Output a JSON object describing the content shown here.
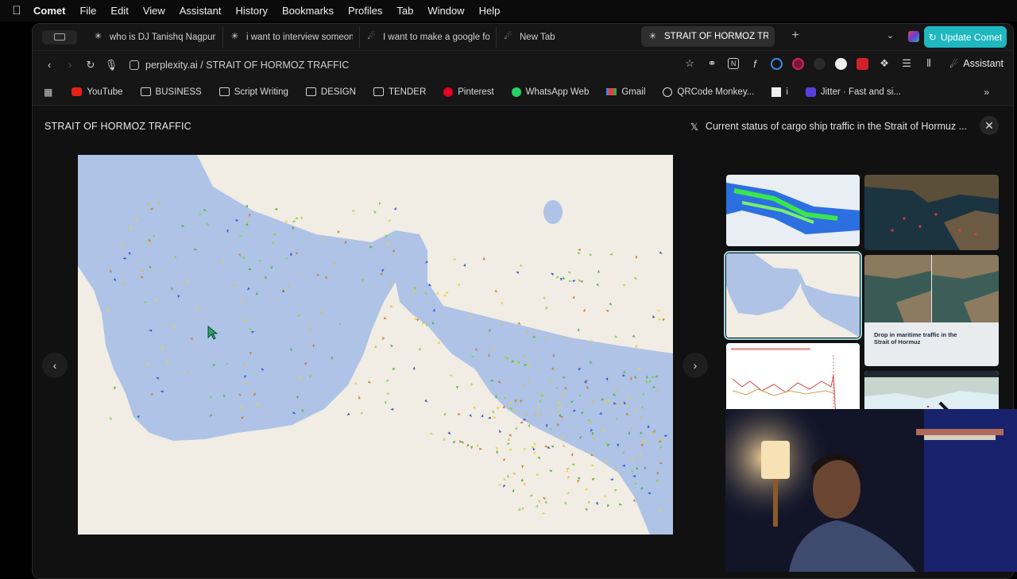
{
  "menubar": {
    "app": "Comet",
    "items": [
      "File",
      "Edit",
      "View",
      "Assistant",
      "History",
      "Bookmarks",
      "Profiles",
      "Tab",
      "Window",
      "Help"
    ]
  },
  "tabs": [
    {
      "label": "who is DJ Tanishq Nagpur, C",
      "icon": "perplexity-icon"
    },
    {
      "label": "i want to interview someone",
      "icon": "perplexity-icon"
    },
    {
      "label": "I want to make a google form",
      "icon": "comet-icon"
    },
    {
      "label": "New Tab",
      "icon": "comet-icon"
    },
    {
      "label": "STRAIT OF HORMOZ TRAFFIC",
      "icon": "perplexity-icon"
    }
  ],
  "update_button": "Update Comet",
  "address": {
    "url": "perplexity.ai / STRAIT OF HORMOZ TRAFFIC",
    "assistant_label": "Assistant"
  },
  "bookmarks": [
    {
      "label": "YouTube",
      "icon": "youtube-icon"
    },
    {
      "label": "BUSINESS",
      "icon": "folder-icon"
    },
    {
      "label": "Script Writing",
      "icon": "folder-icon"
    },
    {
      "label": "DESIGN",
      "icon": "folder-icon"
    },
    {
      "label": "TENDER",
      "icon": "folder-icon"
    },
    {
      "label": "Pinterest",
      "icon": "pinterest-icon"
    },
    {
      "label": "WhatsApp Web",
      "icon": "whatsapp-icon"
    },
    {
      "label": "Gmail",
      "icon": "gmail-icon"
    },
    {
      "label": "QRCode Monkey...",
      "icon": "qrcode-icon"
    },
    {
      "label": "i",
      "icon": "notion-icon"
    },
    {
      "label": "Jitter · Fast and si...",
      "icon": "jitter-icon"
    }
  ],
  "content": {
    "title": "STRAIT OF HORMOZ TRAFFIC",
    "source": "Current status of cargo ship traffic in the Strait of Hormuz ...",
    "source_icon": "x-logo-icon"
  },
  "gallery": {
    "thumb_4": {
      "title": "Drop in maritime traffic in the Strait of Hormuz"
    }
  },
  "colors": {
    "accent": "#1fb8c0",
    "sea": "#aec3e6",
    "land": "#f1ede4"
  }
}
